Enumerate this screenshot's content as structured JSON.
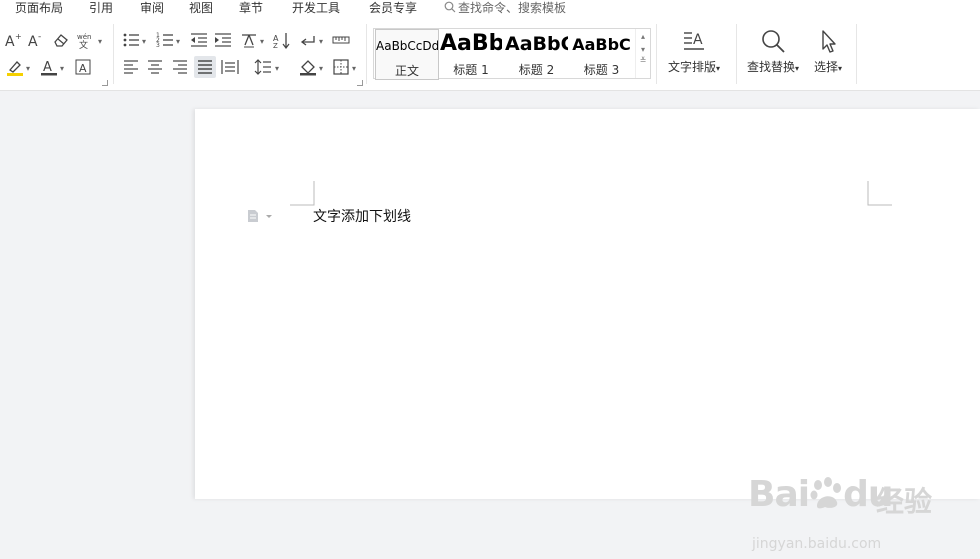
{
  "menubar": {
    "items": [
      "页面布局",
      "引用",
      "审阅",
      "视图",
      "章节",
      "开发工具",
      "会员专享"
    ],
    "search_placeholder": "查找命令、搜索模板"
  },
  "ribbon": {
    "styles": [
      {
        "preview": "AaBbCcDd",
        "name": "正文"
      },
      {
        "preview": "AaBb",
        "name": "标题 1"
      },
      {
        "preview": "AaBbC",
        "name": "标题 2"
      },
      {
        "preview": "AaBbC",
        "name": "标题 3"
      }
    ],
    "text_layout_label": "文字排版",
    "find_replace_label": "查找替换",
    "select_label": "选择",
    "phonetic_glyph": "wén"
  },
  "document": {
    "body_text": "文字添加下划线"
  },
  "watermark": {
    "brand": "Bai",
    "brand2": "du",
    "cn": "经验",
    "url": "jingyan.baidu.com"
  },
  "colors": {
    "accent": "#2b579a",
    "highlight": "#f5d000",
    "font_color": "#e03c31"
  }
}
